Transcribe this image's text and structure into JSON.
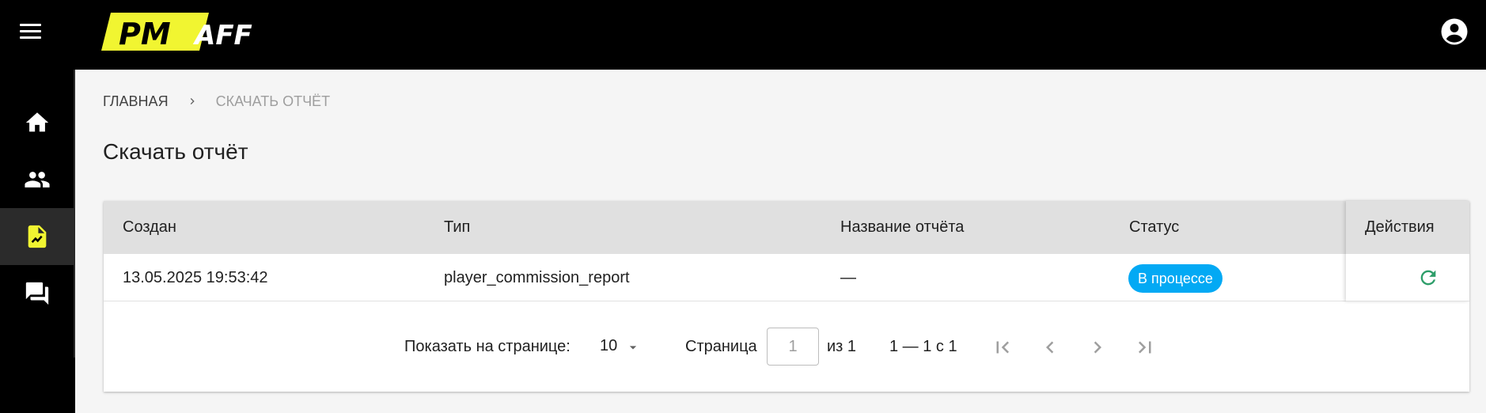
{
  "header": {
    "logo_text_pm": "PM",
    "logo_text_aff": "AFF",
    "menu_icon": "hamburger-menu-icon",
    "account_icon": "account-circle-icon"
  },
  "sidebar": {
    "items": [
      {
        "icon": "home-icon",
        "active": false
      },
      {
        "icon": "people-icon",
        "active": false
      },
      {
        "icon": "report-file-icon",
        "active": true
      },
      {
        "icon": "chat-icon",
        "active": false
      }
    ]
  },
  "breadcrumb": {
    "home": "ГЛАВНАЯ",
    "current": "СКАЧАТЬ ОТЧЁТ"
  },
  "page": {
    "title": "Скачать отчёт"
  },
  "table": {
    "columns": [
      "Создан",
      "Тип",
      "Название отчёта",
      "Статус",
      "Действия"
    ],
    "rows": [
      {
        "created": "13.05.2025 19:53:42",
        "type": "player_commission_report",
        "name": "—",
        "status": "В процессе",
        "action_icon": "refresh-icon"
      }
    ]
  },
  "paginator": {
    "items_per_page_label": "Показать на странице:",
    "items_per_page_value": "10",
    "page_label": "Страница",
    "page_input_value": "1",
    "of_total_label": "из 1",
    "range_label": "1 — 1 с 1"
  },
  "colors": {
    "brand_yellow": "#f1f531",
    "header_bg": "#000000",
    "status_badge": "#03a9f4",
    "refresh_icon": "#2e9e6a"
  }
}
